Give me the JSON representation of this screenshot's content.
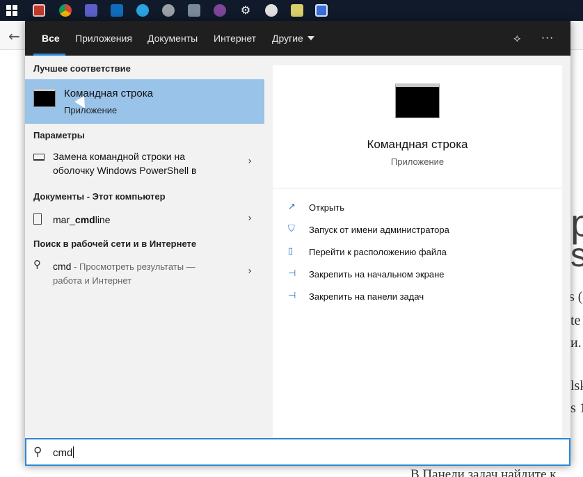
{
  "taskbar": {
    "icons": [
      {
        "name": "tb-app-red-icon",
        "color": "#c0392b"
      },
      {
        "name": "chrome-icon",
        "color": "#e8b73a"
      },
      {
        "name": "teams-icon",
        "color": "#5b5fc7"
      },
      {
        "name": "outlook-icon",
        "color": "#0f6cbd"
      },
      {
        "name": "telegram-icon",
        "color": "#2aa3df"
      },
      {
        "name": "elephant-icon",
        "color": "#9aa0a6"
      },
      {
        "name": "photos-icon",
        "color": "#7a8a99"
      },
      {
        "name": "tor-icon",
        "color": "#7d4698"
      },
      {
        "name": "settings-gear-icon",
        "color": "#ffffff"
      },
      {
        "name": "paint-icon",
        "color": "#e0e0e0"
      },
      {
        "name": "notepad-icon",
        "color": "#d9d06a"
      },
      {
        "name": "app-blue-icon",
        "color": "#3a6fd8"
      }
    ]
  },
  "header": {
    "tabs": [
      "Все",
      "Приложения",
      "Документы",
      "Интернет",
      "Другие"
    ],
    "feedback_icon": "⟡",
    "more_icon": "···"
  },
  "results": {
    "best_match_heading": "Лучшее соответствие",
    "best_match": {
      "title": "Командная строка",
      "subtitle": "Приложение"
    },
    "settings_heading": "Параметры",
    "settings_item": {
      "line1": "Замена командной строки на",
      "line2": "оболочку Windows PowerShell в"
    },
    "documents_heading": "Документы - Этот компьютер",
    "document_item": {
      "prefix": "mar_",
      "bold": "cmd",
      "suffix": "line"
    },
    "web_heading": "Поиск в рабочей сети и в Интернете",
    "web_item": {
      "query": "cmd",
      "desc1": " - Просмотреть результаты —",
      "desc2": "работа и Интернет"
    }
  },
  "preview": {
    "title": "Командная строка",
    "subtitle": "Приложение",
    "actions": [
      "Открыть",
      "Запуск от имени администратора",
      "Перейти к расположению файла",
      "Закрепить на начальном экране",
      "Закрепить на панели задач"
    ]
  },
  "search": {
    "value": "cmd"
  },
  "background_page": {
    "text_frag1": "p",
    "text_frag2": "s",
    "text_frag3": "s (",
    "text_frag4": "te",
    "text_frag5": "и.",
    "text_frag6": "lsk",
    "text_frag7": "s 1",
    "bottom_text": "В Панели задач найдите к"
  },
  "colors": {
    "accent": "#2b88d8",
    "selection": "#99c3e8",
    "header": "#1f1f1f",
    "taskbar": "#101a2a"
  }
}
